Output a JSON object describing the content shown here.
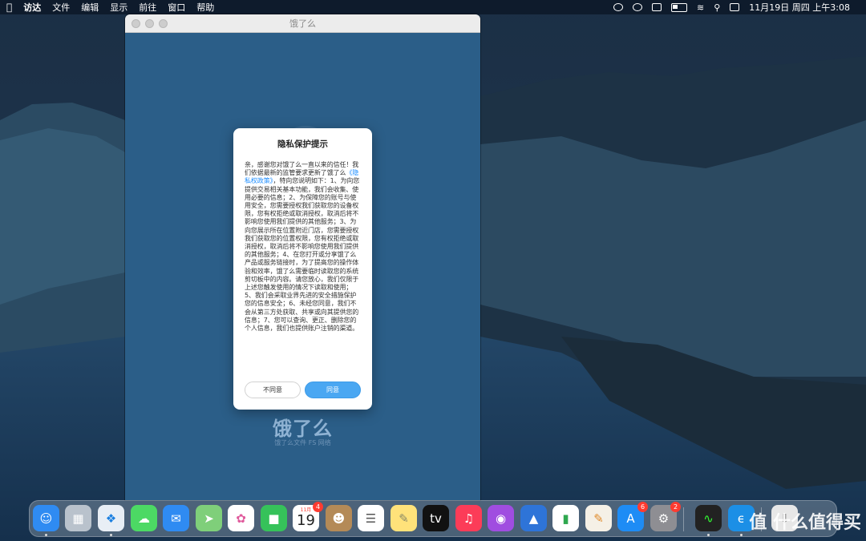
{
  "menubar": {
    "apple_icon": "apple-icon",
    "app_name": "访达",
    "items": [
      "文件",
      "编辑",
      "显示",
      "前往",
      "窗口",
      "帮助"
    ],
    "datetime": "11月19日 周四 上午3:08"
  },
  "window": {
    "title": "饿了么",
    "brand_logo": "饿了么",
    "brand_sub": "饿了么文件 FS 网络"
  },
  "dialog": {
    "title": "隐私保护提示",
    "text_before_link": "亲，感谢您对饿了么一直以来的信任！我们依据最新的监管要求更新了饿了么",
    "link": "《隐私权政策》",
    "text_after_link": "，特向您说明如下：1、为向您提供交易相关基本功能，我们会收集、使用必要的信息；2、为保障您的账号与使用安全，您需要授权我们获取您的设备权限，您有权拒绝或取消授权，取消后将不影响您使用我们提供的其他服务；3、为向您展示所在位置附近门店，您需要授权我们获取您的位置权限，您有权拒绝或取消授权，取消后将不影响您使用我们提供的其他服务；4、在您打开或分享饿了么产品或服务链接时，为了提高您的操作体验和效率，饿了么需要临时读取您的系统剪切板中的内容。请您放心，我们仅限于上述您触发使用的情况下读取和使用；5、我们会采取业界先进的安全措施保护您的信息安全；6、未经您同意，我们不会从第三方处获取、共享或向其提供您的信息；7、您可以查询、更正、删除您的个人信息，我们也提供账户注销的渠道。",
    "disagree_label": "不同意",
    "agree_label": "同意"
  },
  "dock": {
    "calendar_month": "11月",
    "calendar_day": "19",
    "calendar_badge": "4",
    "appstore_badge": "6",
    "settings_badge": "2",
    "watermark": "值 什么值得买"
  },
  "colors": {
    "window_bg": "#2b5e88",
    "agree_button": "#4aa7f2",
    "link": "#1a8cff"
  }
}
